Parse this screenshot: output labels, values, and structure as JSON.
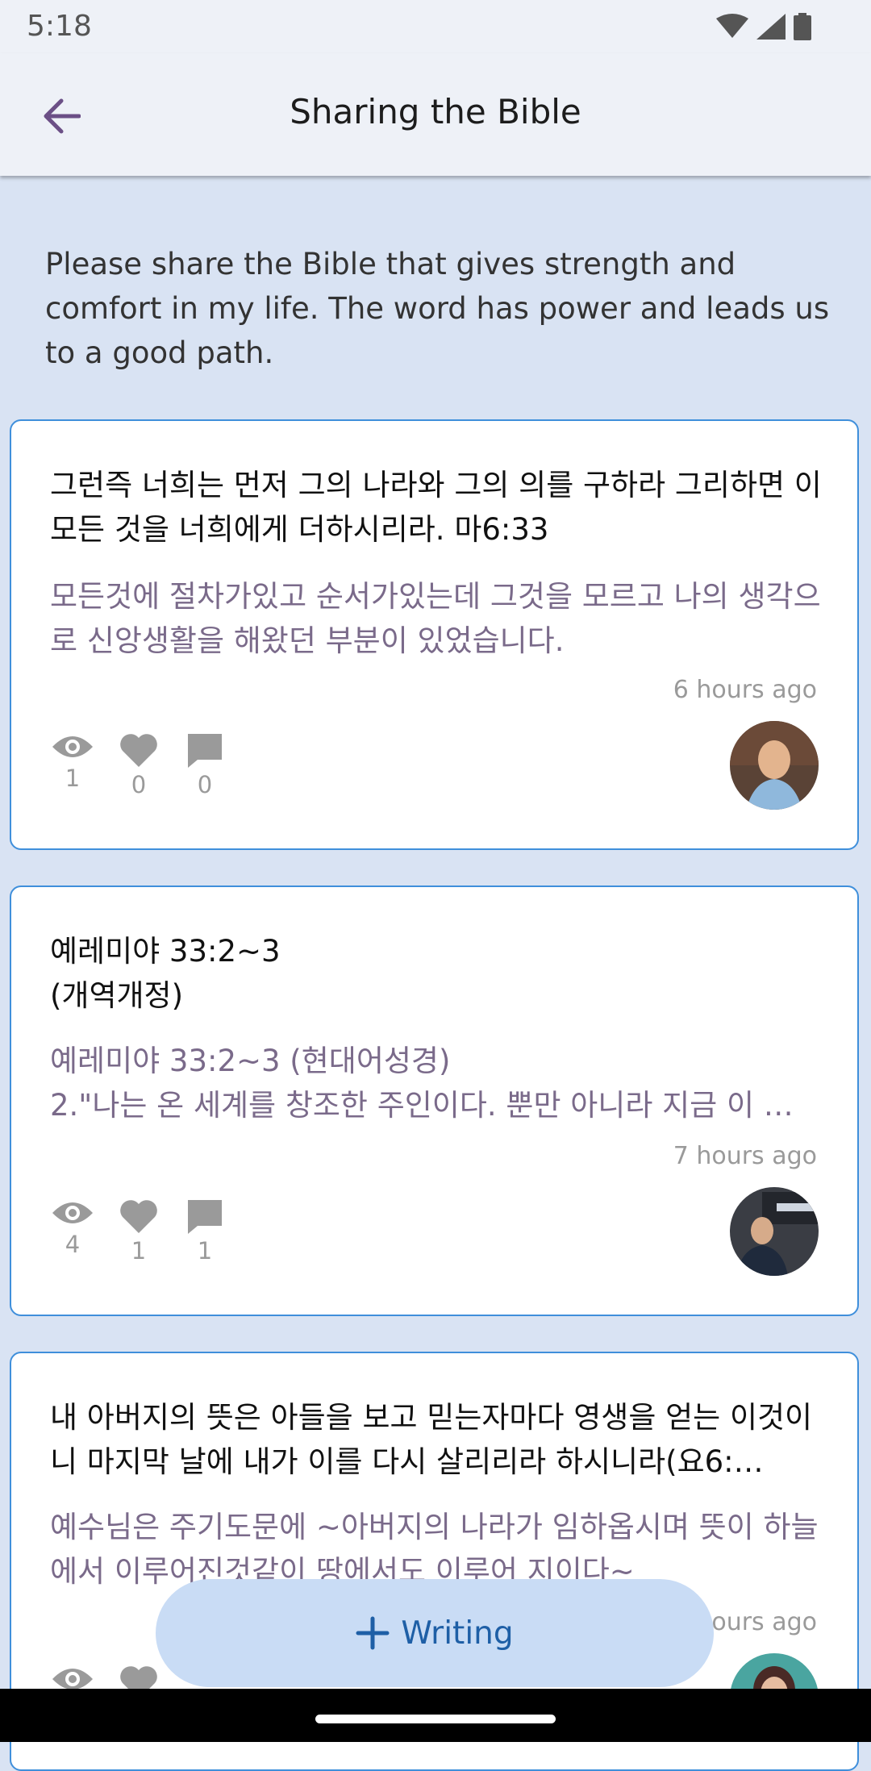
{
  "status_bar": {
    "time": "5:18"
  },
  "app_bar": {
    "title": "Sharing the Bible"
  },
  "intro": "Please share the Bible that gives strength and comfort in my life. The word has power and leads us to a good path.",
  "posts": [
    {
      "title": "그런즉 너희는 먼저 그의 나라와 그의 의를 구하라 그리하면 이 모든 것을 너희에게 더하시리라. 마6:33",
      "body": "모든것에 절차가있고 순서가있는데 그것을 모르고 나의 생각으로 신앙생활을 해왔던 부분이 있었습니다.",
      "time": "6 hours ago",
      "views": "1",
      "likes": "0",
      "comments": "0"
    },
    {
      "title": "예레미야 33:2~3\n(개역개정)",
      "body": "예레미야 33:2~3 (현대어성경)\n2.\"나는 온 세계를 창조한 주인이다. 뿐만 아니라 지금 이 …",
      "time": "7 hours ago",
      "views": "4",
      "likes": "1",
      "comments": "1"
    },
    {
      "title": "내 아버지의 뜻은 아들을 보고 믿는자마다 영생을 얻는 이것이니 마지막 날에 내가 이를 다시 살리리라 하시니라(요6:…",
      "body": "예수님은 주기도문에  ~아버지의 나라가 임하옵시며 뜻이 하늘에서 이루어진것같이 땅에서도 이루어 지이다~",
      "time": "hours ago"
    }
  ],
  "fab": {
    "label": "Writing"
  },
  "colors": {
    "accent": "#1e5fa6",
    "card_border": "#3f8fdb",
    "background": "#d9e3f3"
  }
}
